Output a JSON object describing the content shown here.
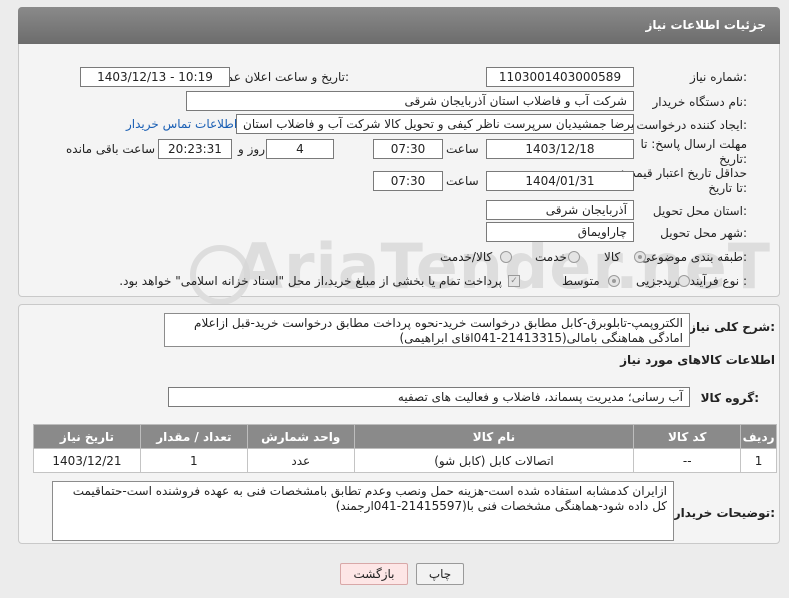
{
  "header": {
    "title": "جزئیات اطلاعات نیاز"
  },
  "fields": {
    "need_number_label": "شماره نیاز:",
    "need_number": "1103001403000589",
    "announce_label": "تاریخ و ساعت اعلان عمومی:",
    "announce_value": "1403/12/13 - 10:19",
    "buyer_org_label": "نام دستگاه خریدار:",
    "buyer_org": "شرکت آب و فاضلاب استان آذربایجان شرقی",
    "requester_label": "ایجاد کننده درخواست:",
    "requester": "علیرضا جمشیدیان سرپرست ناظر کیفی و تحویل کالا شرکت آب و فاضلاب استان",
    "buyer_contact_link": "اطلاعات تماس خریدار",
    "deadline_label": "مهلت ارسال پاسخ: تا تاریخ:",
    "deadline_date": "1403/12/18",
    "time_label": "ساعت",
    "deadline_time": "07:30",
    "days_value": "4",
    "days_label": "روز و",
    "remaining_time": "20:23:31",
    "remaining_label": "ساعت باقی مانده",
    "validity_label": "حداقل تاریخ اعتبار قیمت: تا تاریخ:",
    "validity_date": "1404/01/31",
    "validity_time": "07:30",
    "province_label": "استان محل تحویل:",
    "province": "آذربایجان شرقی",
    "city_label": "شهر محل تحویل:",
    "city": "چاراویماق",
    "category_label": "طبقه بندی موضوعی:",
    "category_options": [
      "کالا",
      "خدمت",
      "کالا/خدمت"
    ],
    "process_label": "نوع فرآیند خرید :",
    "process_options": [
      "جزیی",
      "متوسط"
    ],
    "payment_note": "پرداخت تمام یا بخشی از مبلغ خرید،از محل \"اسناد خزانه اسلامی\" خواهد بود."
  },
  "description": {
    "label": "شرح کلی نیاز:",
    "text": "الکتروپمپ-تابلوبرق-کابل مطابق درخواست خرید-نحوه پرداخت مطابق درخواست خرید-قبل ازاعلام امادگی هماهنگی بامالی(21413315-041اقای ابراهیمی)"
  },
  "goods": {
    "section_title": "اطلاعات کالاهای مورد نیاز",
    "group_label": "گروه کالا:",
    "group_value": "آب رسانی؛ مدیریت پسماند، فاضلاب و فعالیت های تصفیه",
    "columns": [
      "ردیف",
      "کد کالا",
      "نام کالا",
      "واحد شمارش",
      "تعداد / مقدار",
      "تاریخ نیاز"
    ],
    "rows": [
      [
        "1",
        "--",
        "اتصالات کابل (کابل شو)",
        "عدد",
        "1",
        "1403/12/21"
      ]
    ]
  },
  "buyer_notes": {
    "label": "توضیحات خریدار:",
    "text": "ازایران کدمشابه استفاده شده است-هزینه حمل ونصب وعدم تطابق بامشخصات فنی به عهده فروشنده است-حتماقیمت کل داده شود-هماهنگی مشخصات فنی با(21415597-041ارجمند)"
  },
  "buttons": {
    "print": "چاپ",
    "back": "بازگشت"
  },
  "watermark": "AriaTender.neT"
}
